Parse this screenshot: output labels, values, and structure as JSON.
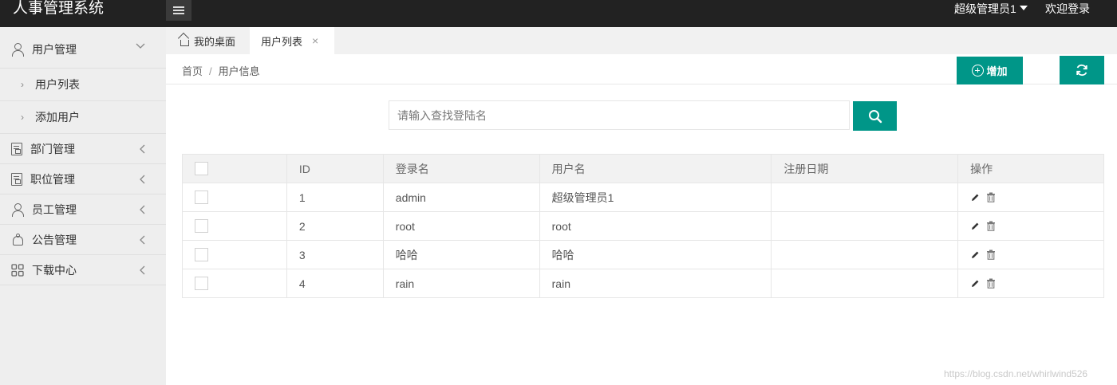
{
  "app": {
    "title": "人事管理系统"
  },
  "topbar": {
    "user": "超级管理员1",
    "logout": "欢迎登录"
  },
  "sidebar": {
    "groups": [
      {
        "label": "用户管理",
        "icon": "user-icon",
        "expanded": true,
        "items": [
          {
            "label": "用户列表"
          },
          {
            "label": "添加用户"
          }
        ]
      },
      {
        "label": "部门管理",
        "icon": "document-icon"
      },
      {
        "label": "职位管理",
        "icon": "document-icon"
      },
      {
        "label": "员工管理",
        "icon": "user-icon"
      },
      {
        "label": "公告管理",
        "icon": "bell-icon"
      },
      {
        "label": "下载中心",
        "icon": "grid-icon"
      }
    ]
  },
  "tabs": [
    {
      "label": "我的桌面",
      "icon": "home-icon"
    },
    {
      "label": "用户列表",
      "active": true,
      "close": "×"
    }
  ],
  "breadcrumb": {
    "home": "首页",
    "separator": "/",
    "current": "用户信息"
  },
  "toolbar": {
    "add_label": "增加",
    "refresh_icon": "refresh-icon"
  },
  "search": {
    "placeholder": "请输入查找登陆名",
    "value": ""
  },
  "table": {
    "columns": [
      "",
      "ID",
      "登录名",
      "用户名",
      "注册日期",
      "操作"
    ],
    "rows": [
      {
        "id": "1",
        "login": "admin",
        "username": "超级管理员1",
        "date": ""
      },
      {
        "id": "2",
        "login": "root",
        "username": "root",
        "date": ""
      },
      {
        "id": "3",
        "login": "哈哈",
        "username": "哈哈",
        "date": ""
      },
      {
        "id": "4",
        "login": "rain",
        "username": "rain",
        "date": ""
      }
    ]
  },
  "watermark": "https://blog.csdn.net/whirlwind526",
  "colors": {
    "primary": "#009688",
    "topbar": "#222222",
    "sidebar": "#eeeeee"
  }
}
